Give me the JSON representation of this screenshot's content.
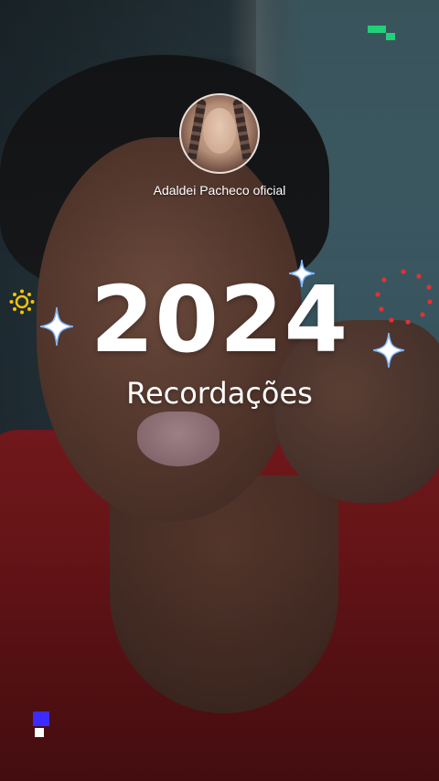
{
  "profile": {
    "name": "Adaldei Pacheco oficial"
  },
  "recap": {
    "year": "2024",
    "subtitle": "Recordações"
  },
  "decorations": {
    "sparkle_color": "#ffffff",
    "sparkle_glow": "#7fb6ff",
    "accent_green": "#22d07a",
    "accent_blue": "#3b2bff",
    "accent_red": "#e23232",
    "accent_yellow": "#f5c400",
    "icons": [
      "sparkle-icon",
      "sun-ring-icon",
      "dotted-circle-icon",
      "pixel-blocks-icon"
    ]
  }
}
